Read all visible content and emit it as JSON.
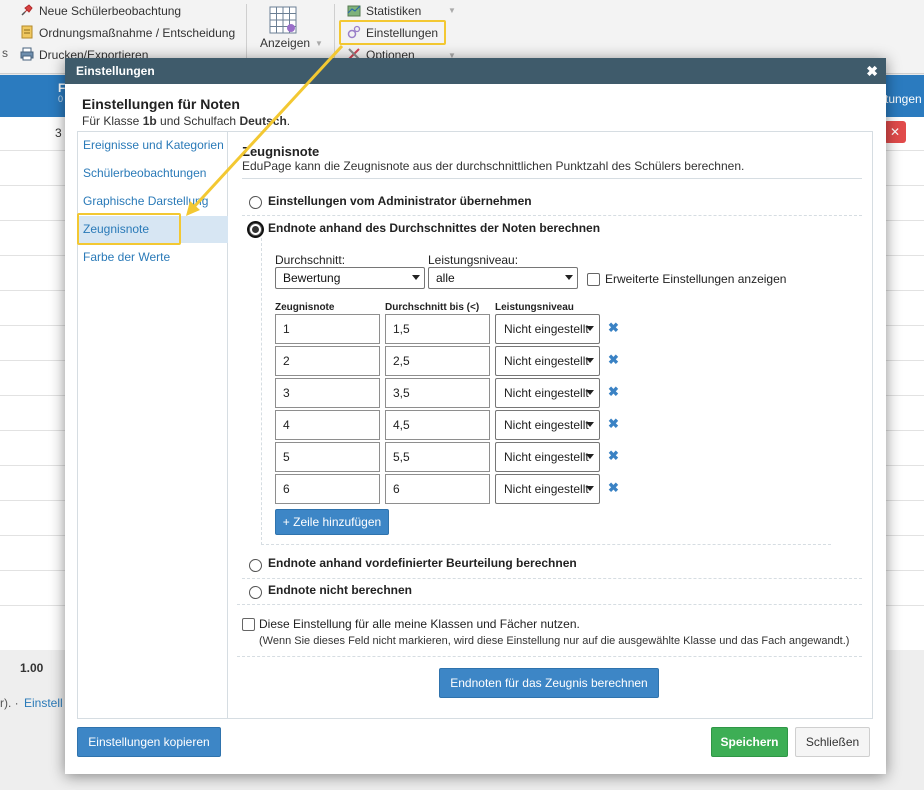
{
  "toolbar": {
    "items": [
      {
        "label": "Neue Schülerbeobachtung",
        "icon": "pin-icon"
      },
      {
        "label": "Ordnungsmaßnahme / Entscheidung",
        "icon": "document-icon"
      },
      {
        "label": "Drucken/Exportieren",
        "icon": "printer-icon"
      }
    ],
    "view_label": "Anzeigen",
    "statistics_label": "Statistiken",
    "settings_label": "Einstellungen",
    "options_label": "Optionen",
    "cut_left": "s"
  },
  "background": {
    "col_header_cut": "F",
    "col_header_cut2": "0",
    "right_header_cut": "tungen",
    "row_value": "3",
    "total_value": "1.00",
    "footer_cut": "r). ·",
    "footer_link_cut": "Einstell"
  },
  "modal": {
    "header_title": "Einstellungen",
    "close_glyph": "✖",
    "title": "Einstellungen für Noten",
    "subtitle_prefix": "Für Klasse ",
    "class_name": "1b",
    "subtitle_middle": " und Schulfach ",
    "subject_name": "Deutsch",
    "subtitle_suffix": "."
  },
  "sidebar": {
    "items": [
      {
        "label": "Ereignisse und Kategorien",
        "active": false
      },
      {
        "label": "Schülerbeobachtungen",
        "active": false
      },
      {
        "label": "Graphische Darstellung",
        "active": false
      },
      {
        "label": "Zeugnisnote",
        "active": true
      },
      {
        "label": "Farbe der Werte",
        "active": false
      }
    ]
  },
  "content": {
    "section_title": "Zeugnisnote",
    "section_desc": "EduPage kann die Zeugnisnote aus der durchschnittlichen Punktzahl des Schülers berechnen.",
    "options": [
      {
        "label": "Einstellungen vom Administrator übernehmen",
        "checked": false
      },
      {
        "label": "Endnote anhand des Durchschnittes der Noten berechnen",
        "checked": true
      },
      {
        "label": "Endnote anhand vordefinierter Beurteilung berechnen",
        "checked": false
      },
      {
        "label": "Endnote nicht berechnen",
        "checked": false
      }
    ],
    "average_label": "Durchschnitt:",
    "average_value": "Bewertung",
    "level_label": "Leistungsniveau:",
    "level_value": "alle",
    "advanced_label": "Erweiterte Einstellungen anzeigen",
    "table": {
      "headers": [
        "Zeugnisnote",
        "Durchschnitt bis (<)",
        "Leistungsniveau"
      ],
      "rows": [
        {
          "grade": "1",
          "avg": "1,5",
          "level": "Nicht eingestellt"
        },
        {
          "grade": "2",
          "avg": "2,5",
          "level": "Nicht eingestellt"
        },
        {
          "grade": "3",
          "avg": "3,5",
          "level": "Nicht eingestellt"
        },
        {
          "grade": "4",
          "avg": "4,5",
          "level": "Nicht eingestellt"
        },
        {
          "grade": "5",
          "avg": "5,5",
          "level": "Nicht eingestellt"
        },
        {
          "grade": "6",
          "avg": "6",
          "level": "Nicht eingestellt"
        }
      ],
      "remove_glyph": "✖"
    },
    "add_row_label": "+ Zeile hinzufügen",
    "use_all_label": "Diese Einstellung für alle meine Klassen und Fächer nutzen.",
    "use_all_note": "(Wenn Sie dieses Feld nicht markieren, wird diese Einstellung nur auf die ausgewählte Klasse und das Fach angewandt.)",
    "calc_button": "Endnoten für das Zeugnis berechnen"
  },
  "footer": {
    "copy_button": "Einstellungen kopieren",
    "save_button": "Speichern",
    "close_button": "Schließen"
  },
  "colors": {
    "accent_blue": "#3d86c6",
    "highlight_yellow": "#f3c832",
    "header_dark": "#3f5b6b",
    "save_green": "#3dae55"
  }
}
